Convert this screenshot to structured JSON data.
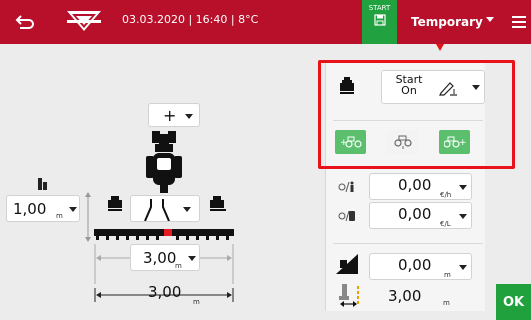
{
  "header": {
    "status_text": "03.03.2020 | 16:40 | 8°C",
    "record_label": "START",
    "profile_label": "Temporary"
  },
  "hitch": {
    "label": "+"
  },
  "section_control": {
    "mode_value_line1": "Start",
    "mode_value_line2": "On"
  },
  "left_offset": {
    "value": "1,00",
    "unit": "m"
  },
  "working_width": {
    "value": "3,00",
    "unit": "m"
  },
  "total_width": {
    "value": "3,00",
    "unit": "m"
  },
  "costs": {
    "per_hour_value": "0,00",
    "per_hour_unit": "€/h",
    "per_liter_value": "0,00",
    "per_liter_unit": "€/L"
  },
  "slope": {
    "value": "0,00",
    "unit": "m"
  },
  "track_width": {
    "value": "3,00",
    "unit": "m"
  },
  "ok_label": "OK",
  "colors": {
    "brand_red": "#b8102a",
    "accent_green": "#22a140",
    "highlight_red": "#e8121b"
  }
}
